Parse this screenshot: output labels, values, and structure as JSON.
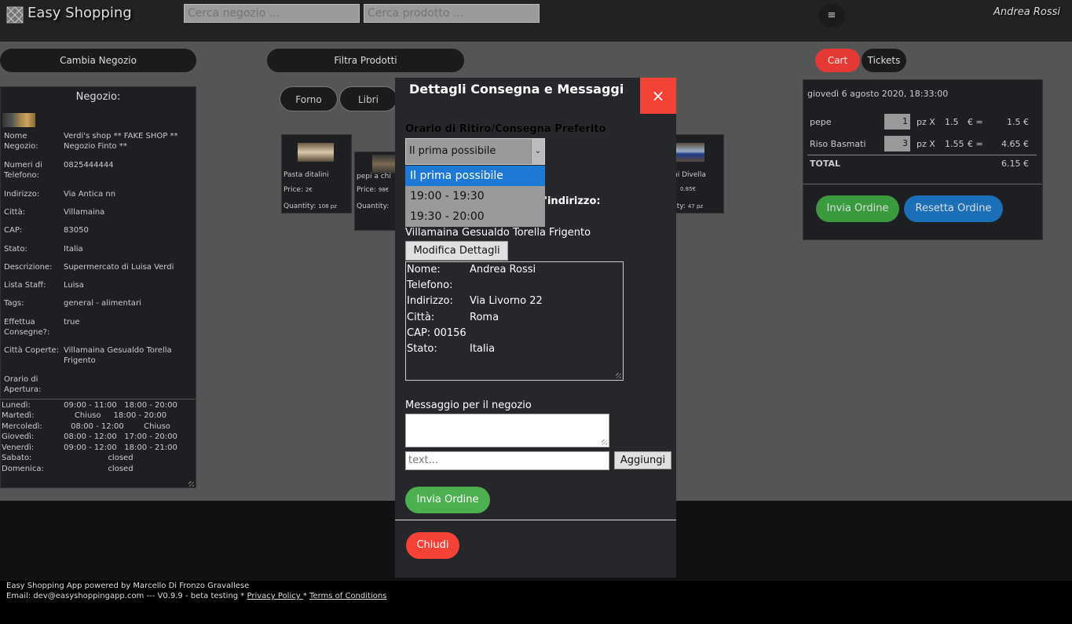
{
  "header": {
    "app_title": "Easy Shopping",
    "search_shop_placeholder": "Cerca negozio ...",
    "search_product_placeholder": "Cerca prodotto ...",
    "menu_icon": "≡",
    "user_name": "Andrea Rossi"
  },
  "toolbar": {
    "change_shop": "Cambia Negozio",
    "filter_products": "Filtra Prodotti",
    "cart": "Cart",
    "tickets": "Tickets"
  },
  "categories": [
    "Forno",
    "Libri"
  ],
  "shop": {
    "header": "Negozio:",
    "fields": [
      {
        "k": "Nome Negozio:",
        "v": "Verdi's shop ** FAKE SHOP ** Negozio Finto **"
      },
      {
        "k": "Numeri di Telefono:",
        "v": "0825444444"
      },
      {
        "k": "Indirizzo:",
        "v": "Via Antica nn"
      },
      {
        "k": "Città:",
        "v": "Villamaina"
      },
      {
        "k": "CAP:",
        "v": "83050"
      },
      {
        "k": "Stato:",
        "v": "Italia"
      },
      {
        "k": "Descrizione:",
        "v": "Supermercato di Luisa Verdi"
      },
      {
        "k": "Lista Staff:",
        "v": "Luisa"
      },
      {
        "k": "Tags:",
        "v": "general - alimentari"
      },
      {
        "k": "Effettua Consegne?:",
        "v": "true"
      },
      {
        "k": "Città Coperte:",
        "v": "Villamaina Gesualdo Torella Frigento"
      },
      {
        "k": "Orario di Apertura:",
        "v": ""
      }
    ],
    "hours": [
      {
        "d": "Lunedì:",
        "h": "09:00 - 11:00   18:00 - 20:00"
      },
      {
        "d": "Martedì:",
        "h": "Chiuso     18:00 - 20:00"
      },
      {
        "d": "Mercoledì:",
        "h": "08:00 - 12:00        Chiuso"
      },
      {
        "d": "Giovedì:",
        "h": "08:00 - 12:00   17:00 - 20:00"
      },
      {
        "d": "Venerdì:",
        "h": "09:00 - 12:00   18:00 - 21:00"
      },
      {
        "d": "Sabato:",
        "h": "closed"
      },
      {
        "d": "Domenica:",
        "h": "closed"
      }
    ]
  },
  "products": [
    {
      "name": "Pasta ditalini",
      "price_label": "Price:",
      "price": "2€",
      "qty_label": "Quantity:",
      "qty": "108 pz"
    },
    {
      "name": "pepi a chi",
      "price_label": "Price:",
      "price": "98€",
      "qty_label": "Quantity:",
      "qty": ""
    },
    {
      "name": "ni Divella",
      "price_label": "",
      "price": "0.85€",
      "qty_label": "ntity:",
      "qty": "47 pz"
    }
  ],
  "cart": {
    "date": "giovedì 6 agosto 2020, 18:33:00",
    "items": [
      {
        "name": "pepe",
        "qty": "1",
        "unit": "pz X",
        "price": "1.5",
        "eq": "€ =",
        "total": "1.5 €"
      },
      {
        "name": "Riso Basmati",
        "qty": "3",
        "unit": "pz X",
        "price": "1.55",
        "eq": "€ =",
        "total": "4.65 €"
      }
    ],
    "total_label": "TOTAL",
    "total_value": "6.15 €",
    "send_order": "Invia Ordine",
    "reset_order": "Resetta Ordine"
  },
  "modal": {
    "title": "Dettagli Consegna e Messaggi",
    "close_x": "×",
    "time_label": "Orario di Ritiro/Consegna Preferito",
    "selected": "Il prima possibile",
    "options": [
      "Il prima possibile",
      "19:00 - 19:30",
      "19:30 - 20:00"
    ],
    "addr_label_partial": "'indirizzo:",
    "cities": "Villamaina Gesualdo Torella Frigento",
    "modify_details": "Modifica Dettagli",
    "address": [
      {
        "l": "Nome:",
        "r": "Andrea Rossi"
      },
      {
        "l": "Telefono:",
        "r": ""
      },
      {
        "l": "Indirizzo:",
        "r": "Via Livorno 22"
      },
      {
        "l": "Città:",
        "r": "Roma"
      },
      {
        "l": "CAP:  00156",
        "r": ""
      },
      {
        "l": "Stato:",
        "r": "Italia"
      }
    ],
    "message_label": "Messaggio per il negozio",
    "text_placeholder": "text...",
    "add_button": "Aggiungi",
    "send_order": "Invia Ordine",
    "close_button": "Chiudi"
  },
  "footer": {
    "line1": "Easy Shopping App powered by Marcello Di Fronzo Gravallese",
    "line2": "Email: dev@easyshoppingapp.com --- V0.9.9 - beta testing * ",
    "privacy": "Privacy Policy ",
    "sep": "* ",
    "terms": "Terms of Conditions"
  }
}
